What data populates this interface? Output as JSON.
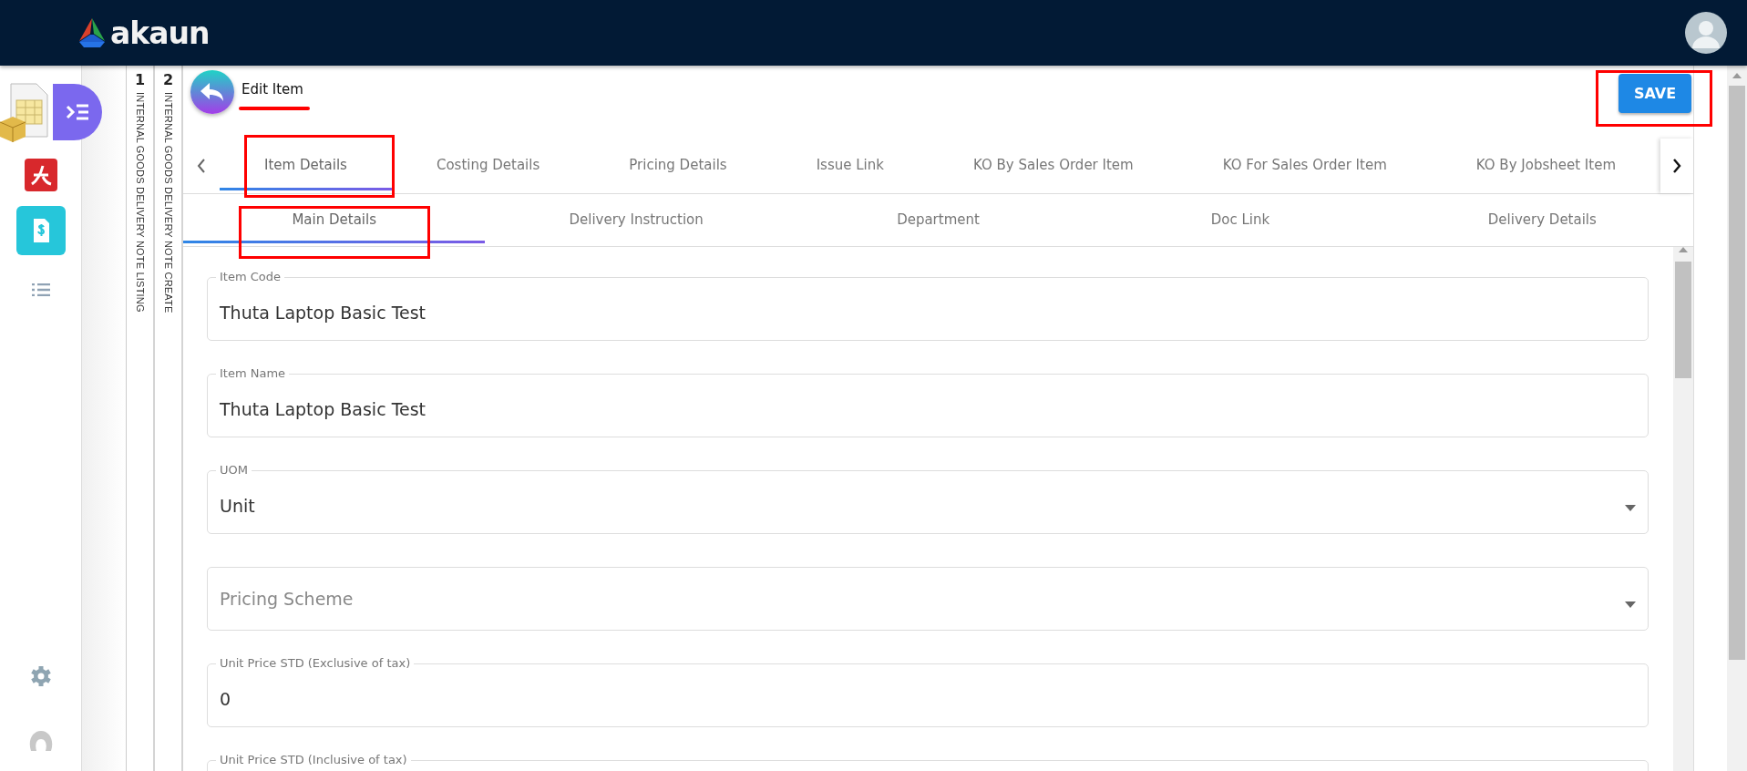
{
  "top_bar": {
    "logo_text": "akaun"
  },
  "pages": [
    {
      "number": "1",
      "title": "INTERNAL GOODS DELIVERY NOTE LISTING"
    },
    {
      "number": "2",
      "title": "INTERNAL GOODS DELIVERY NOTE CREATE"
    }
  ],
  "header": {
    "title": "Edit Item",
    "save_label": "SAVE"
  },
  "tabs": [
    {
      "label": "Item Details",
      "selected": true
    },
    {
      "label": "Costing Details",
      "selected": false
    },
    {
      "label": "Pricing Details",
      "selected": false
    },
    {
      "label": "Issue Link",
      "selected": false
    },
    {
      "label": "KO By Sales Order Item",
      "selected": false
    },
    {
      "label": "KO For Sales Order Item",
      "selected": false
    },
    {
      "label": "KO By Jobsheet Item",
      "selected": false
    }
  ],
  "sub_tabs": [
    {
      "label": "Main Details",
      "selected": true
    },
    {
      "label": "Delivery Instruction",
      "selected": false
    },
    {
      "label": "Department",
      "selected": false
    },
    {
      "label": "Doc Link",
      "selected": false
    },
    {
      "label": "Delivery Details",
      "selected": false
    }
  ],
  "fields": [
    {
      "kind": "text",
      "label": "Item Code",
      "value": "Thuta Laptop Basic Test"
    },
    {
      "kind": "text",
      "label": "Item Name",
      "value": "Thuta Laptop Basic Test"
    },
    {
      "kind": "select",
      "label": "UOM",
      "value": "Unit"
    },
    {
      "kind": "select",
      "placeholder": "Pricing Scheme"
    },
    {
      "kind": "text",
      "label": "Unit Price STD (Exclusive of tax)",
      "value": "0"
    },
    {
      "kind": "text",
      "label": "Unit Price STD (Inclusive of tax)"
    }
  ]
}
